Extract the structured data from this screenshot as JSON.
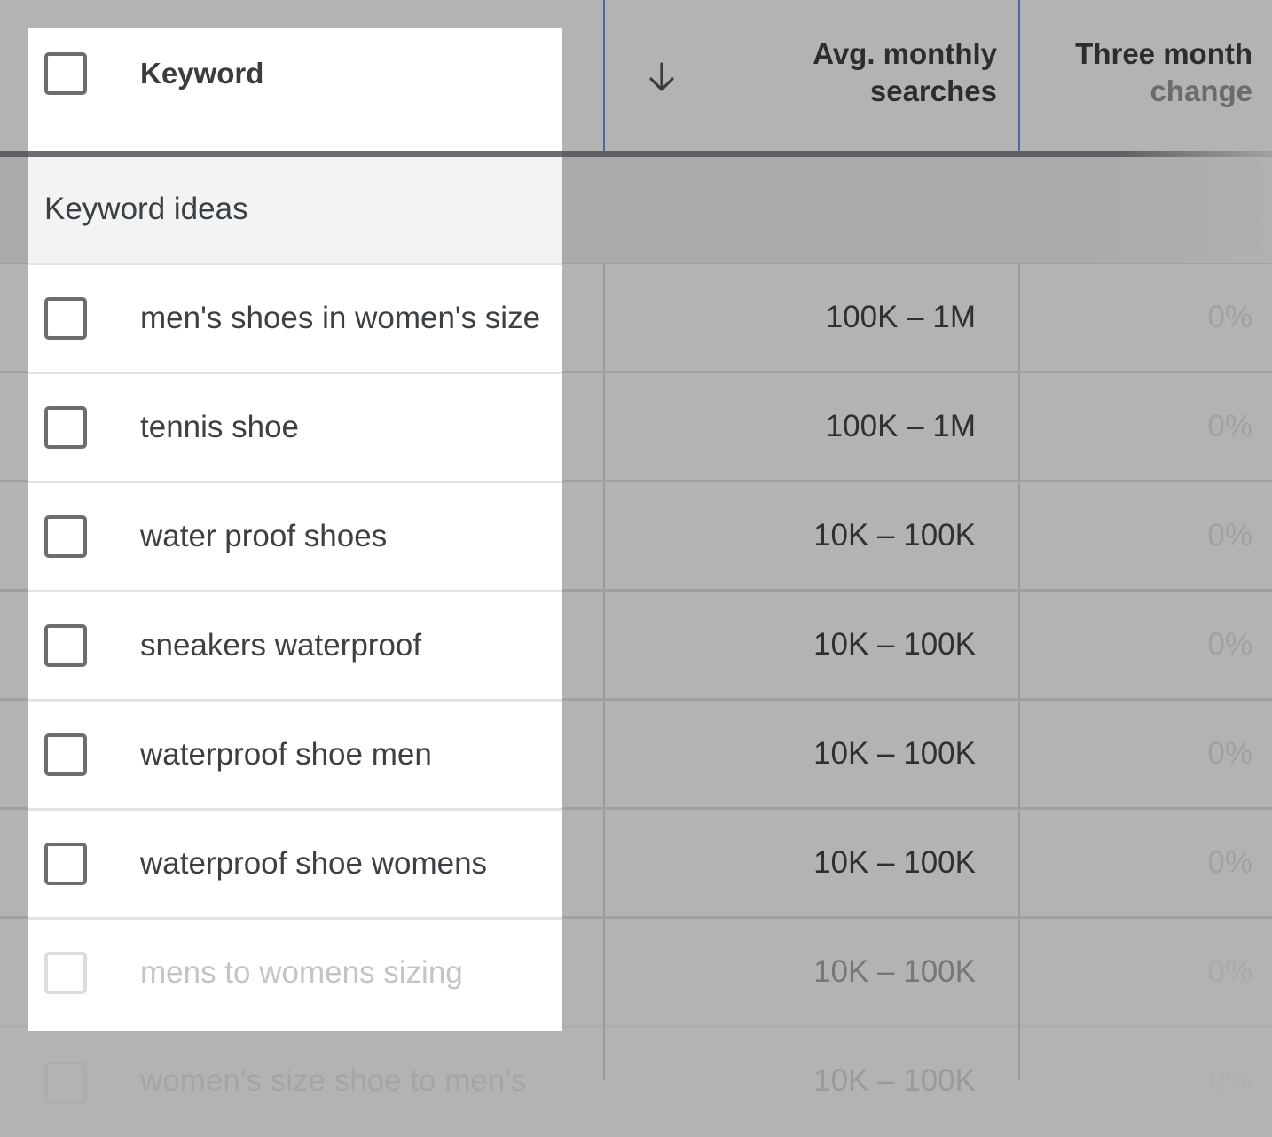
{
  "header": {
    "select_all_label": "",
    "keyword_col": "Keyword",
    "sort_icon": "arrow-down-icon",
    "avg_monthly_searches_line1": "Avg. monthly",
    "avg_monthly_searches_line2": "searches",
    "three_month_change_line1": "Three month",
    "three_month_change_line2": "change"
  },
  "group": {
    "label": "Keyword ideas"
  },
  "rows": [
    {
      "keyword": "men's shoes in women's size",
      "avg_monthly_searches": "100K – 1M",
      "three_month_change": "0%"
    },
    {
      "keyword": "tennis shoe",
      "avg_monthly_searches": "100K – 1M",
      "three_month_change": "0%"
    },
    {
      "keyword": "water proof shoes",
      "avg_monthly_searches": "10K – 100K",
      "three_month_change": "0%"
    },
    {
      "keyword": "sneakers waterproof",
      "avg_monthly_searches": "10K – 100K",
      "three_month_change": "0%"
    },
    {
      "keyword": "waterproof shoe men",
      "avg_monthly_searches": "10K – 100K",
      "three_month_change": "0%"
    },
    {
      "keyword": "waterproof shoe womens",
      "avg_monthly_searches": "10K – 100K",
      "three_month_change": "0%"
    },
    {
      "keyword": "mens to womens sizing",
      "avg_monthly_searches": "10K – 100K",
      "three_month_change": "0%"
    },
    {
      "keyword": "women's size shoe to men's",
      "avg_monthly_searches": "10K – 100K",
      "three_month_change": "0%"
    }
  ],
  "colors": {
    "overlay": "#b3b3b3",
    "highlight": "#ffffff",
    "group_row_highlight": "#f1f3f4",
    "column_divider_accent": "#4a6aa8"
  }
}
